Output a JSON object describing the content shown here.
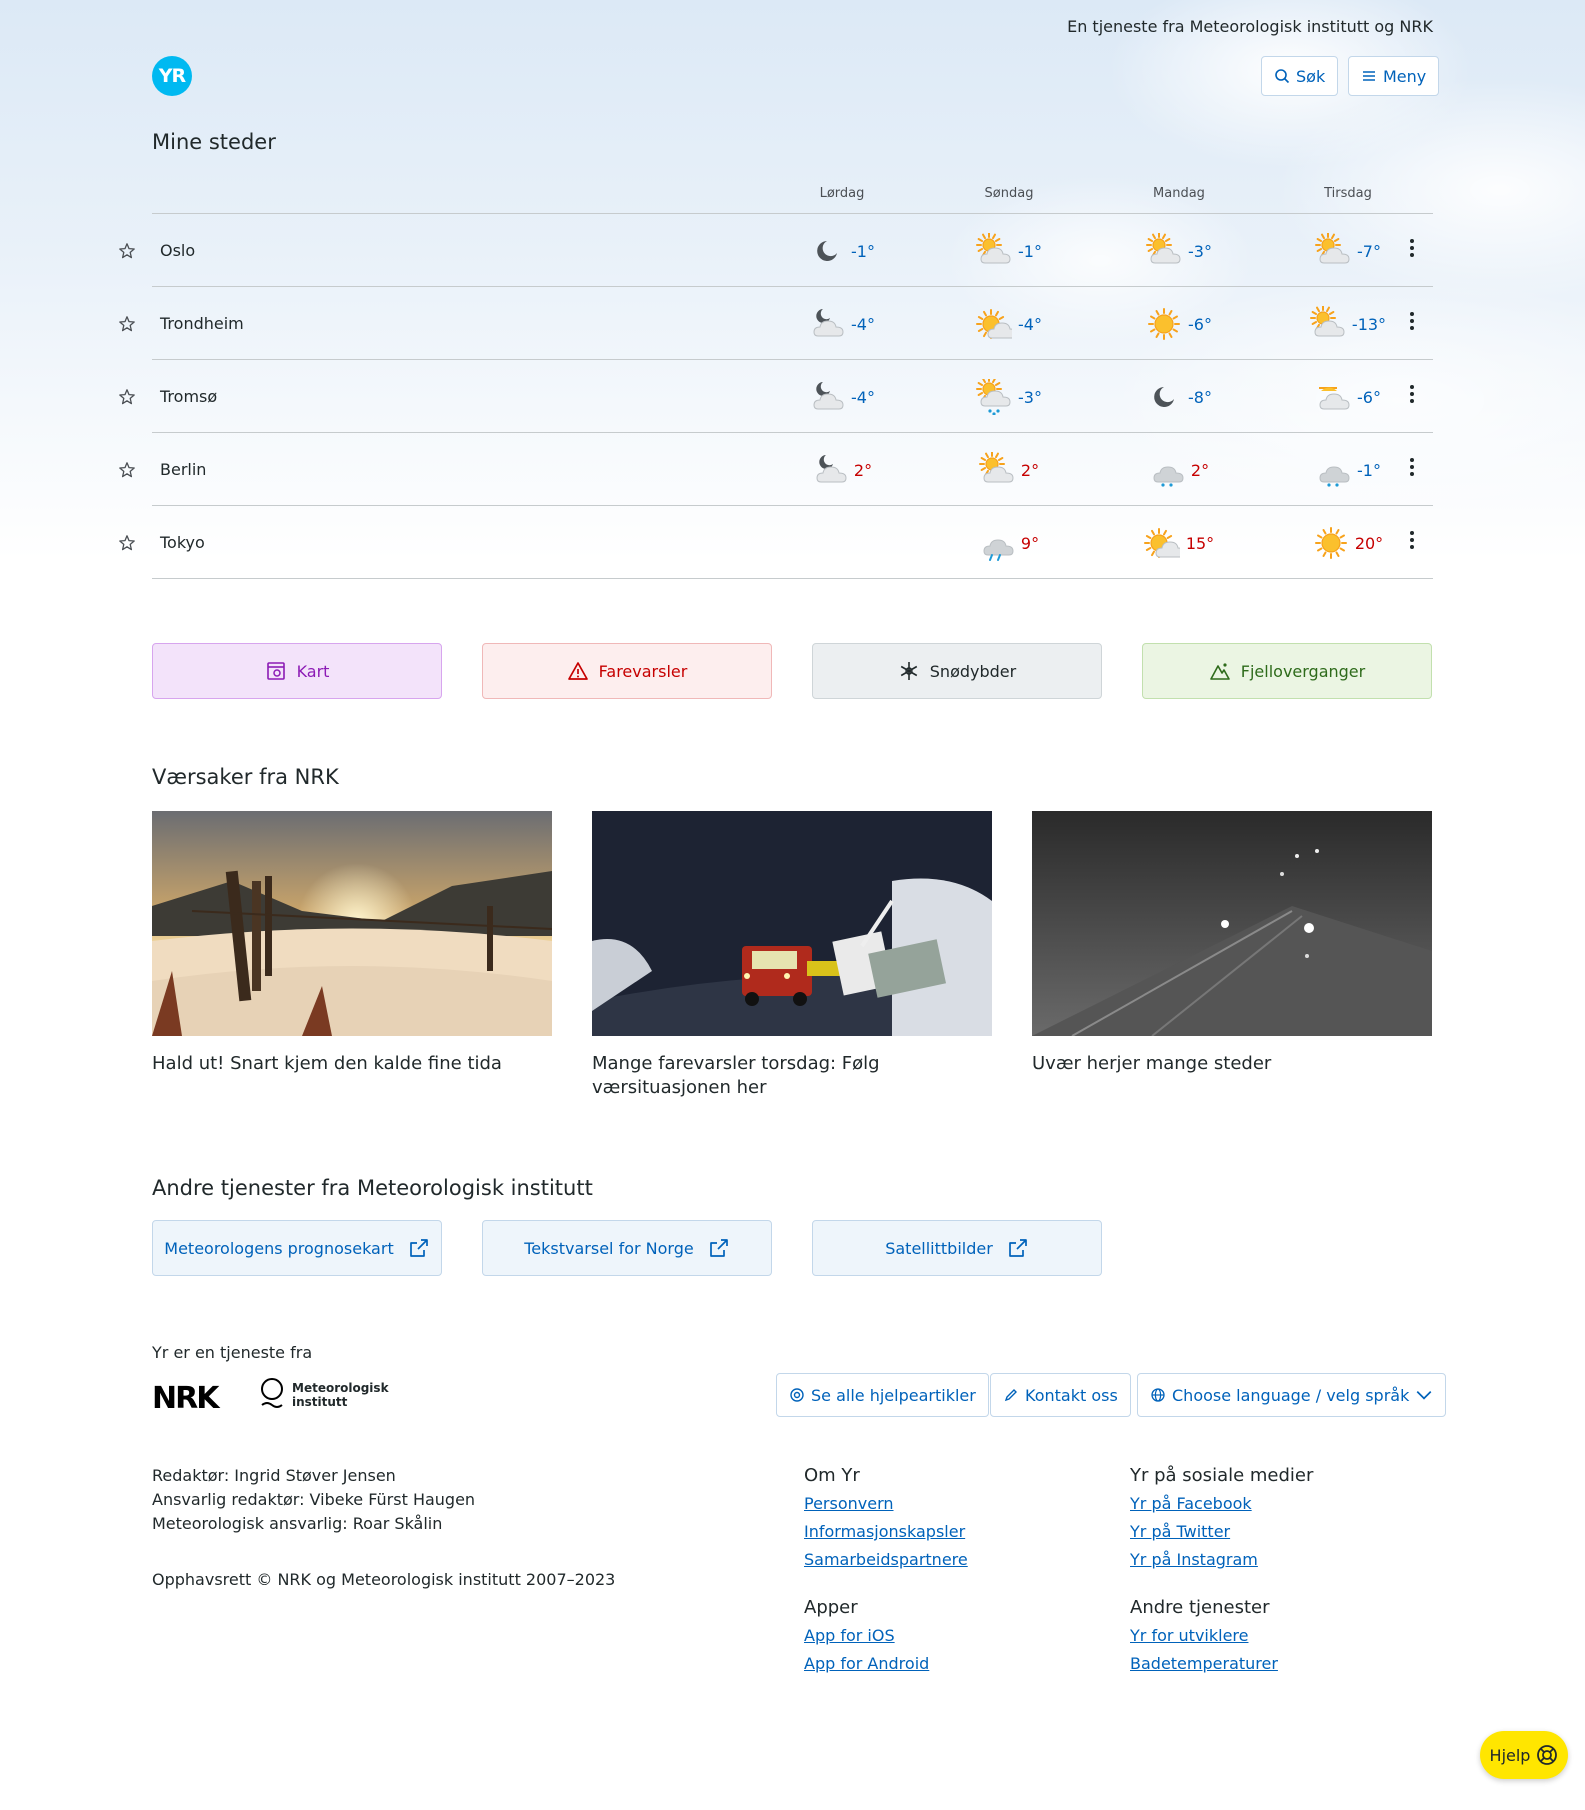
{
  "header": {
    "tagline": "En tjeneste fra Meteorologisk institutt og NRK",
    "logo_text": "YR",
    "search_label": "Søk",
    "menu_label": "Meny"
  },
  "places": {
    "title": "Mine steder",
    "days": [
      "Lørdag",
      "Søndag",
      "Mandag",
      "Tirsdag"
    ],
    "rows": [
      {
        "name": "Oslo",
        "forecast": [
          {
            "icon": "moon-icon",
            "temp": "-1°",
            "tone": "cold"
          },
          {
            "icon": "partly-cloudy-icon",
            "temp": "-1°",
            "tone": "cold"
          },
          {
            "icon": "partly-cloudy-icon",
            "temp": "-3°",
            "tone": "cold"
          },
          {
            "icon": "partly-cloudy-icon",
            "temp": "-7°",
            "tone": "cold"
          }
        ]
      },
      {
        "name": "Trondheim",
        "forecast": [
          {
            "icon": "night-cloudy-icon",
            "temp": "-4°",
            "tone": "cold"
          },
          {
            "icon": "fair-icon",
            "temp": "-4°",
            "tone": "cold"
          },
          {
            "icon": "sun-icon",
            "temp": "-6°",
            "tone": "cold"
          },
          {
            "icon": "partly-cloudy-icon",
            "temp": "-13°",
            "tone": "cold"
          }
        ]
      },
      {
        "name": "Tromsø",
        "forecast": [
          {
            "icon": "night-cloudy-icon",
            "temp": "-4°",
            "tone": "cold"
          },
          {
            "icon": "snow-showers-icon",
            "temp": "-3°",
            "tone": "cold"
          },
          {
            "icon": "moon-icon",
            "temp": "-8°",
            "tone": "cold"
          },
          {
            "icon": "polar-twilight-cloudy-icon",
            "temp": "-6°",
            "tone": "cold"
          }
        ]
      },
      {
        "name": "Berlin",
        "forecast": [
          {
            "icon": "night-cloudy-icon",
            "temp": "2°",
            "tone": "warm"
          },
          {
            "icon": "partly-cloudy-icon",
            "temp": "2°",
            "tone": "warm"
          },
          {
            "icon": "sleet-icon",
            "temp": "2°",
            "tone": "warm"
          },
          {
            "icon": "sleet-icon",
            "temp": "-1°",
            "tone": "cold"
          }
        ]
      },
      {
        "name": "Tokyo",
        "forecast": [
          {
            "icon": "",
            "temp": "",
            "tone": ""
          },
          {
            "icon": "rain-icon",
            "temp": "9°",
            "tone": "warm"
          },
          {
            "icon": "fair-icon",
            "temp": "15°",
            "tone": "warm"
          },
          {
            "icon": "sun-icon",
            "temp": "20°",
            "tone": "warm"
          }
        ]
      }
    ]
  },
  "quicklinks": [
    {
      "label": "Kart",
      "icon": "map-icon",
      "color": "#8c1bb5",
      "bg": "#f3e3fa",
      "border": "#d7a5ee"
    },
    {
      "label": "Farevarsler",
      "icon": "warning-triangle-icon",
      "color": "#c60000",
      "bg": "#fdeeee",
      "border": "#f0b8b8"
    },
    {
      "label": "Snødybder",
      "icon": "snowflake-icon",
      "color": "#21292b",
      "bg": "#eceff1",
      "border": "#cfd5d8"
    },
    {
      "label": "Fjelloverganger",
      "icon": "mountain-icon",
      "color": "#2e6b1b",
      "bg": "#ebf5e3",
      "border": "#c2e0ae"
    }
  ],
  "articles": {
    "title": "Værsaker fra NRK",
    "items": [
      {
        "caption": "Hald ut! Snart kjem den kalde fine tida"
      },
      {
        "caption": "Mange farevarsler torsdag: Følg værsituasjonen her"
      },
      {
        "caption": "Uvær herjer mange steder"
      }
    ]
  },
  "services": {
    "title": "Andre tjenester fra Meteorologisk institutt",
    "items": [
      "Meteorologens prognosekart",
      "Tekstvarsel for Norge",
      "Satellittbilder"
    ]
  },
  "footer": {
    "service_of": "Yr er en tjeneste fra",
    "nrk_logo": "NRK",
    "met_logo_line1": "Meteorologisk",
    "met_logo_line2": "institutt",
    "help_articles": "Se alle hjelpeartikler",
    "contact": "Kontakt oss",
    "language": "Choose language / velg språk",
    "editor": "Redaktør: Ingrid Støver Jensen",
    "resp_editor": "Ansvarlig redaktør: Vibeke Fürst Haugen",
    "met_resp": "Meteorologisk ansvarlig: Roar Skålin",
    "copyright": "Opphavsrett © NRK og Meteorologisk institutt 2007–2023",
    "columns": [
      {
        "title": "Om Yr",
        "links": [
          "Personvern",
          "Informasjonskapsler",
          "Samarbeidspartnere"
        ]
      },
      {
        "title": "Yr på sosiale medier",
        "links": [
          "Yr på Facebook",
          "Yr på Twitter",
          "Yr på Instagram"
        ]
      },
      {
        "title": "Apper",
        "links": [
          "App for iOS",
          "App for Android"
        ]
      },
      {
        "title": "Andre tjenester",
        "links": [
          "Yr for utviklere",
          "Badetemperaturer"
        ]
      }
    ],
    "help_button": "Hjelp"
  }
}
